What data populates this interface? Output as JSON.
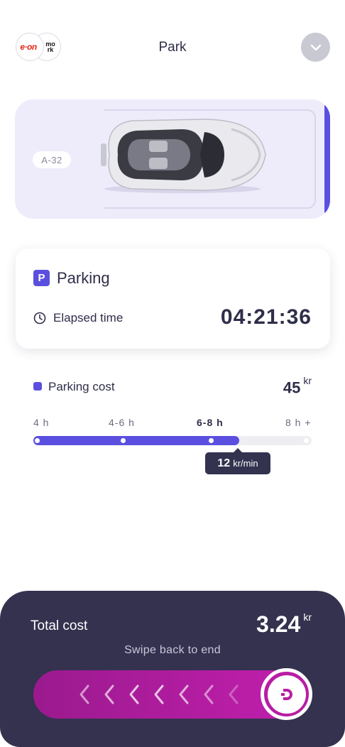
{
  "header": {
    "logo_text_eon": "e·on",
    "logo_text_mo": "mo",
    "logo_text_rk": "rk",
    "title": "Park"
  },
  "car_card": {
    "spot_label": "A-32"
  },
  "parking": {
    "title": "Parking",
    "icon_letter": "P",
    "elapsed_label": "Elapsed time",
    "elapsed_time": "04:21:36"
  },
  "cost": {
    "label": "Parking cost",
    "value": "45",
    "unit": "kr",
    "tiers": [
      "4 h",
      "4-6 h",
      "6-8 h",
      "8 h +"
    ],
    "active_tier_index": 2,
    "progress_fraction": 0.74,
    "rate_value": "12",
    "rate_unit": "kr/min"
  },
  "bottom": {
    "total_label": "Total cost",
    "total_value": "3.24",
    "total_unit": "kr",
    "swipe_hint": "Swipe back to end"
  },
  "colors": {
    "accent": "#5b4fe0",
    "dark_panel": "#34324f",
    "slider": "#c21fae"
  }
}
